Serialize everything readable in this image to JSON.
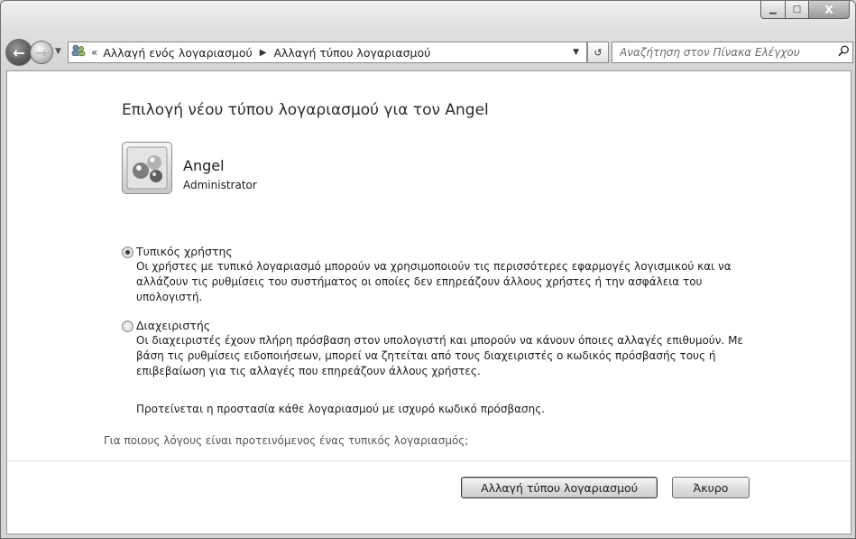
{
  "window": {
    "caption": {
      "minimize": "▁",
      "maximize": "□",
      "close": "X"
    }
  },
  "navbar": {
    "back_glyph": "←",
    "forward_glyph": "→",
    "recent_glyph": "▼",
    "address_icon": "users-icon",
    "chevrons": "«",
    "breadcrumbs": [
      "Αλλαγή ενός λογαριασμού",
      "Αλλαγή τύπου λογαριασμού"
    ],
    "separator": "▶",
    "dropdown_glyph": "▼",
    "refresh_glyph": "↺",
    "search_placeholder": "Αναζήτηση στον Πίνακα Ελέγχου",
    "search_glyph": "⚲"
  },
  "main": {
    "title": "Επιλογή νέου τύπου λογαριασμού για τον Angel",
    "user": {
      "name": "Angel",
      "role": "Administrator"
    },
    "options": [
      {
        "label": "Τυπικός χρήστης",
        "checked": true,
        "description": "Οι χρήστες με τυπικό λογαριασμό μπορούν να χρησιμοποιούν τις περισσότερες εφαρμογές λογισμικού και να αλλάζουν τις ρυθμίσεις του συστήματος οι οποίες δεν επηρεάζουν άλλους χρήστες ή την ασφάλεια του υπολογιστή."
      },
      {
        "label": "Διαχειριστής",
        "checked": false,
        "description": "Οι διαχειριστές έχουν πλήρη πρόσβαση στον υπολογιστή και μπορούν να κάνουν όποιες αλλαγές επιθυμούν. Με βάση τις ρυθμίσεις ειδοποιήσεων, μπορεί να ζητείται από τους διαχειριστές ο κωδικός πρόσβασής τους ή επιβεβαίωση για τις αλλαγές που επηρεάζουν άλλους χρήστες."
      }
    ],
    "recommendation": "Προτείνεται η προστασία κάθε λογαριασμού με ισχυρό κωδικό πρόσβασης.",
    "help_link": "Για ποιους λόγους είναι προτεινόμενος ένας τυπικός λογαριασμός;",
    "buttons": {
      "primary": "Αλλαγή τύπου λογαριασμού",
      "cancel": "Άκυρο"
    }
  }
}
